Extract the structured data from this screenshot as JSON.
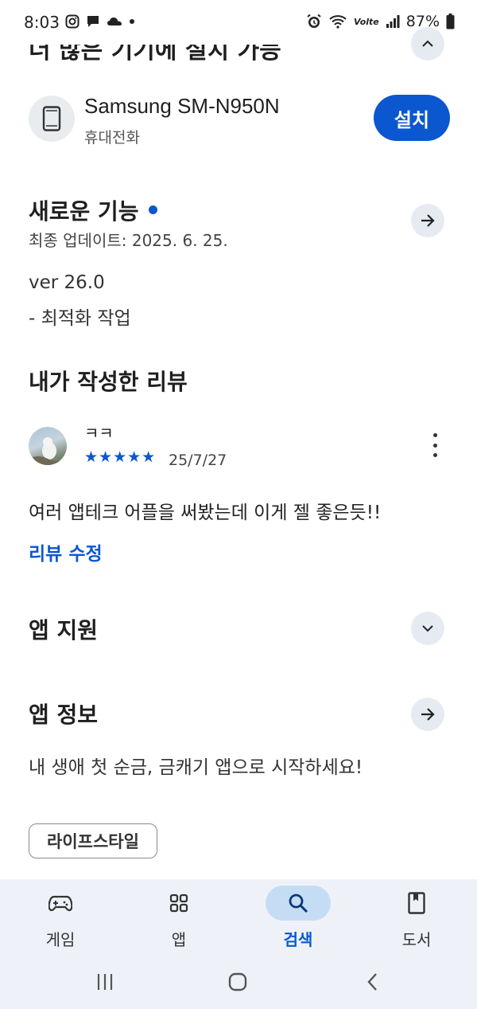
{
  "status_bar": {
    "time": "8:03",
    "battery": "87%",
    "network_label": "Volte"
  },
  "top": {
    "clipped_title": "더 많은 기기에 설치 가능"
  },
  "device": {
    "name": "Samsung SM-N950N",
    "type": "휴대전화",
    "install_label": "설치"
  },
  "whats_new": {
    "title": "새로운 기능",
    "updated": "최종 업데이트: 2025. 6. 25.",
    "version": "ver 26.0",
    "note": "- 최적화 작업"
  },
  "my_review": {
    "title": "내가 작성한 리뷰",
    "reviewer": "ㅋㅋ",
    "stars": "★★★★★",
    "rating": 5,
    "date": "25/7/27",
    "text": "여러 앱테크 어플을 써봤는데 이게 젤 좋은듯!!",
    "edit_label": "리뷰 수정"
  },
  "app_support": {
    "title": "앱 지원"
  },
  "about_app": {
    "title": "앱 정보",
    "description": "내 생애 첫 순금, 금캐기 앱으로 시작하세요!",
    "category_chip": "라이프스타일"
  },
  "bottom_nav": {
    "items": [
      {
        "label": "게임",
        "icon": "gamepad-icon",
        "active": false
      },
      {
        "label": "앱",
        "icon": "apps-grid-icon",
        "active": false
      },
      {
        "label": "검색",
        "icon": "search-icon",
        "active": true
      },
      {
        "label": "도서",
        "icon": "book-icon",
        "active": false
      }
    ]
  },
  "colors": {
    "accent": "#0b57d0",
    "nav_background": "#eef2f8",
    "active_pill": "#c5dcf5"
  }
}
